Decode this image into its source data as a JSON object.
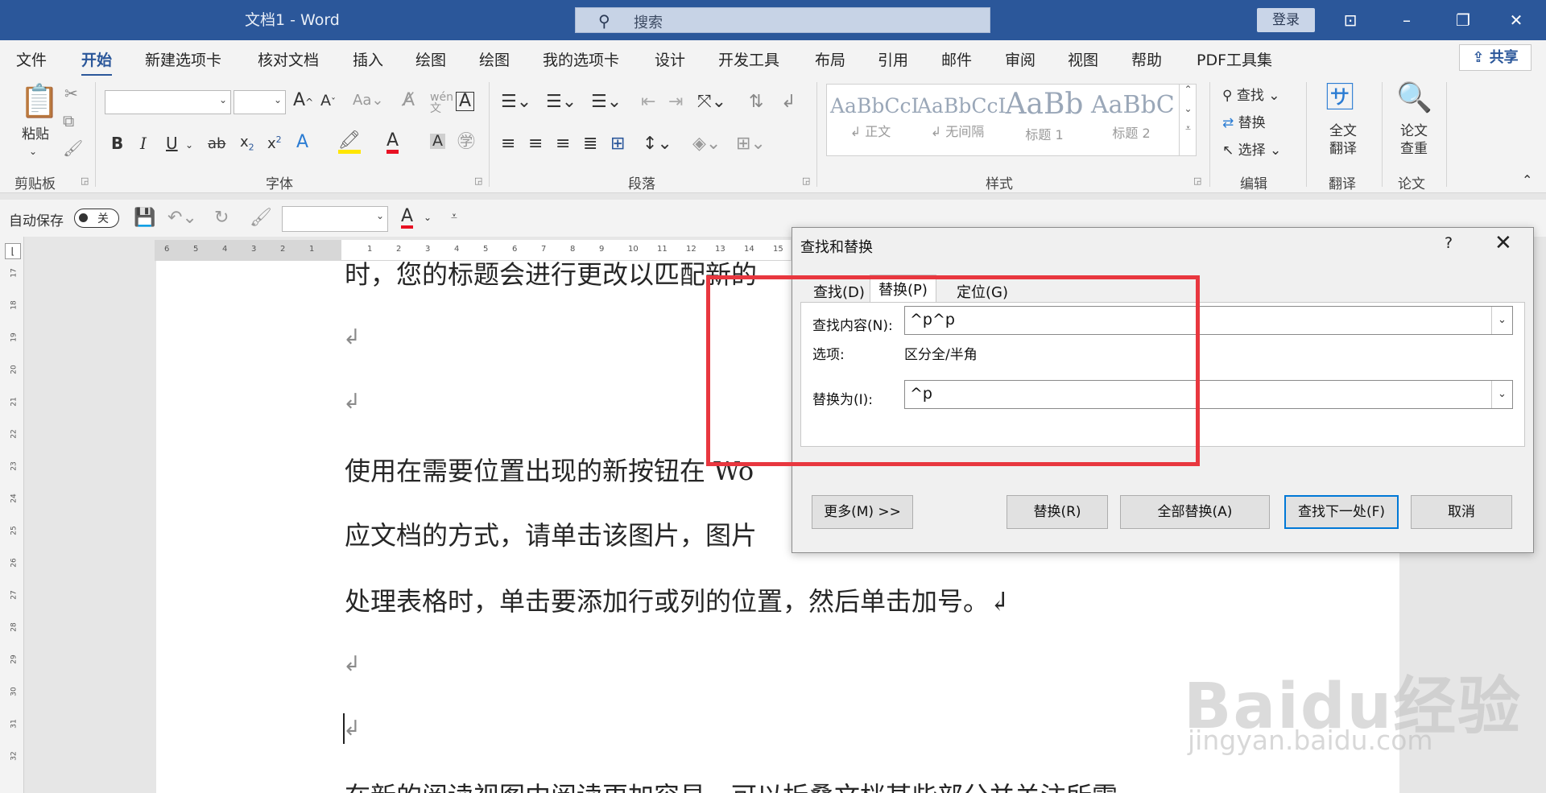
{
  "window": {
    "title": "文档1 - Word",
    "search_placeholder": "搜索",
    "login_label": "登录",
    "controls": [
      "⊡",
      "–",
      "❐",
      "✕"
    ]
  },
  "ribbon_tabs": [
    "文件",
    "开始",
    "新建选项卡",
    "核对文档",
    "插入",
    "绘图",
    "绘图",
    "我的选项卡",
    "设计",
    "开发工具",
    "布局",
    "引用",
    "邮件",
    "审阅",
    "视图",
    "帮助",
    "PDF工具集"
  ],
  "active_tab": "开始",
  "share_label": "共享",
  "groups": {
    "clipboard": {
      "label": "剪贴板",
      "paste_label": "粘贴"
    },
    "font": {
      "label": "字体"
    },
    "paragraph": {
      "label": "段落"
    },
    "styles": {
      "label": "样式",
      "tiles": [
        {
          "sample": "AaBbCcI",
          "name": "↲ 正文"
        },
        {
          "sample": "AaBbCcI",
          "name": "↲ 无间隔"
        },
        {
          "sample": "AaBb",
          "name": "标题 1"
        },
        {
          "sample": "AaBbC",
          "name": "标题 2"
        }
      ]
    },
    "editing": {
      "label": "编辑",
      "find": "查找",
      "replace": "替换",
      "select": "选择"
    },
    "translate": {
      "label": "翻译",
      "btn_line1": "全文",
      "btn_line2": "翻译"
    },
    "paper": {
      "label": "论文",
      "btn_line1": "论文",
      "btn_line2": "查重"
    }
  },
  "qat": {
    "autosave_label": "自动保存",
    "toggle_state": "关"
  },
  "ruler": {
    "h_numbers": [
      "6",
      "5",
      "4",
      "3",
      "2",
      "1",
      "1",
      "2",
      "3",
      "4",
      "5",
      "6",
      "7",
      "8",
      "9",
      "10",
      "11",
      "12",
      "13",
      "14",
      "15"
    ],
    "v_numbers": [
      "17",
      "18",
      "19",
      "20",
      "21",
      "22",
      "23",
      "24",
      "25",
      "26",
      "27",
      "28",
      "29",
      "30",
      "31",
      "32"
    ]
  },
  "document": {
    "lines": [
      "时，您的标题会进行更改以匹配新的",
      "使用在需要位置出现的新按钮在 Wo",
      "应文档的方式，请单击该图片，图片",
      "处理表格时，单击要添加行或列的位置，然后单击加号。↲",
      "在新的阅读视图中阅读更加容易。可以折叠文档某些部分并关注所需"
    ],
    "paragraph_mark": "↲"
  },
  "dialog": {
    "title": "查找和替换",
    "help": "?",
    "close": "✕",
    "tabs": [
      "查找(D)",
      "替换(P)",
      "定位(G)"
    ],
    "selected_tab": "替换(P)",
    "find_label": "查找内容(N):",
    "find_value": "^p^p",
    "options_label": "选项:",
    "options_value": "区分全/半角",
    "replace_label": "替换为(I):",
    "replace_value": "^p",
    "buttons": {
      "more": "更多(M) >>",
      "replace": "替换(R)",
      "replace_all": "全部替换(A)",
      "find_next": "查找下一处(F)",
      "cancel": "取消"
    }
  },
  "annotation_color": "#e8373f",
  "watermark": {
    "logo": "Baidu经验",
    "url": "jingyan.baidu.com"
  }
}
